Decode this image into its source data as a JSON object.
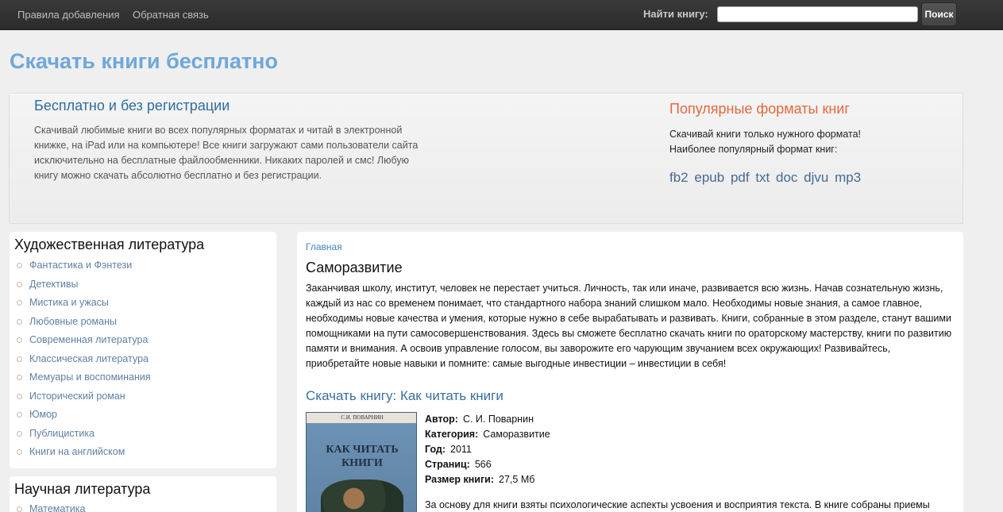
{
  "navbar": {
    "links": [
      "Правила добавления",
      "Обратная связь"
    ],
    "search_label": "Найти книгу:",
    "search_value": "",
    "search_button": "Поиск"
  },
  "site_title": "Скачать книги бесплатно",
  "hero": {
    "title": "Бесплатно и без регистрации",
    "text": "Скачивай любимые книги во всех популярных форматах и читай в электронной книжке, на iPad или на компьютере! Все книги загружают сами пользователи сайта исключительно на бесплатные файлообменники. Никаких паролей и смс! Любую книгу можно скачать абсолютно бесплатно и без регистрации.",
    "formats_title": "Популярные форматы книг",
    "formats_line1": "Скачивай книги только нужного формата!",
    "formats_line2": "Наиболее популярный формат книг:",
    "formats": [
      "fb2",
      "epub",
      "pdf",
      "txt",
      "doc",
      "djvu",
      "mp3"
    ]
  },
  "sidebar": {
    "fiction_title": "Художественная литература",
    "fiction_items": [
      "Фантастика и Фэнтези",
      "Детективы",
      "Мистика и ужасы",
      "Любовные романы",
      "Современная литература",
      "Классическая литература",
      "Мемуары и воспоминания",
      "Исторический роман",
      "Юмор",
      "Публицистика",
      "Книги на английском"
    ],
    "science_title": "Научная литература",
    "science_items": [
      "Математика"
    ]
  },
  "main": {
    "breadcrumb": "Главная",
    "title": "Саморазвитие",
    "intro": "Заканчивая школу, институт, человек не перестает учиться. Личность, так или иначе, развивается всю жизнь. Начав сознательную жизнь, каждый из нас со временем понимает, что стандартного набора знаний слишком мало. Необходимы новые знания, а самое главное, необходимы новые качества и умения, которые нужно в себе вырабатывать и развивать. Книги, собранные в этом разделе, станут вашими помощниками на пути самосовершенствования. Здесь вы сможете бесплатно скачать книги по ораторскому мастерству, книги по развитию памяти и внимания. А освоив управление голосом, вы заворожите его чарующим звучанием всех окружающих! Развивайтесь, приобретайте новые навыки и помните: самые выгодные инвестиции – инвестиции в себя!",
    "book": {
      "heading": "Скачать книгу: Как читать книги",
      "cover_author": "С.И. ПОВАРНИН",
      "cover_title": "КАК ЧИТАТЬ КНИГИ",
      "author_label": "Автор:",
      "author": "С. И. Поварнин",
      "category_label": "Категория:",
      "category": "Саморазвитие",
      "year_label": "Год:",
      "year": "2011",
      "pages_label": "Страниц:",
      "pages": "566",
      "size_label": "Размер книги:",
      "size": "27,5 Мб",
      "description": "За основу для книги взяты психологические аспекты усвоения и восприятия текста. В книге собраны приемы"
    }
  }
}
